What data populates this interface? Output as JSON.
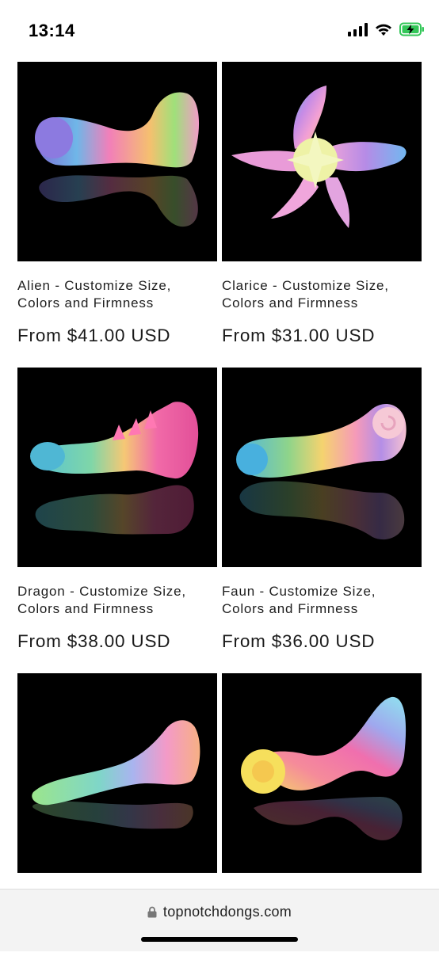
{
  "status_bar": {
    "time": "13:14",
    "icons": [
      "signal-icon",
      "wifi-icon",
      "battery-charging-icon"
    ]
  },
  "products": [
    {
      "title": "Alien - Customize Size,\nColors and Firmness",
      "price": "From $41.00 USD"
    },
    {
      "title": "Clarice - Customize Size,\nColors and Firmness",
      "price": "From $31.00 USD"
    },
    {
      "title": "Dragon - Customize Size,\nColors and Firmness",
      "price": "From $38.00 USD"
    },
    {
      "title": "Faun - Customize Size,\nColors and Firmness",
      "price": "From $36.00 USD"
    },
    {
      "title": "",
      "price": ""
    },
    {
      "title": "",
      "price": ""
    }
  ],
  "browser": {
    "url": "topnotchdongs.com",
    "lock_icon": "lock-icon"
  },
  "colors": {
    "image_background": "#000000",
    "battery_green": "#34c759"
  }
}
